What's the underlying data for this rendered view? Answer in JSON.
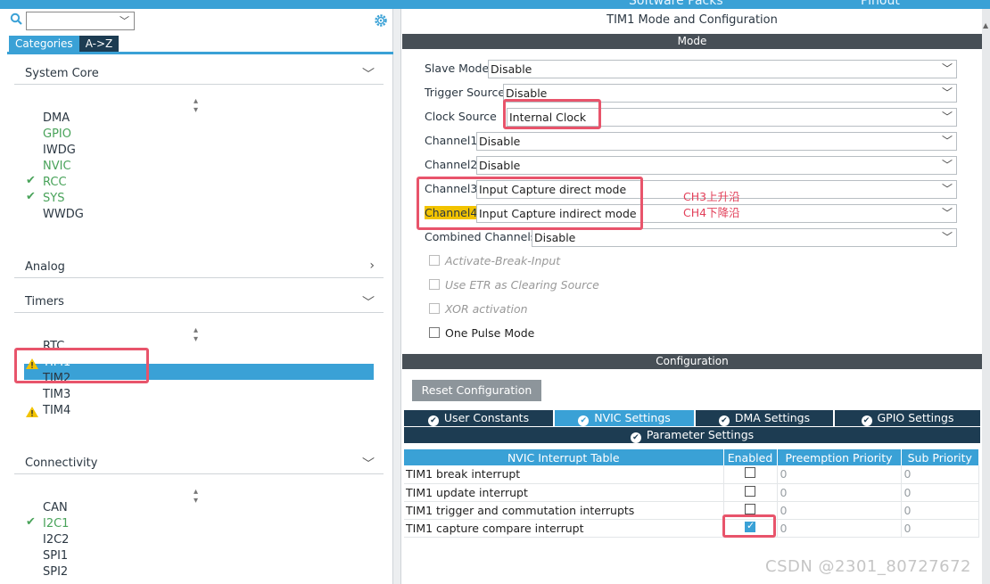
{
  "top": {
    "left_text": "Software Packs",
    "right_text": "Pinout"
  },
  "search": {
    "value": ""
  },
  "tabs": {
    "categories": "Categories",
    "az": "A->Z"
  },
  "sections": {
    "system_core": {
      "label": "System Core",
      "items": [
        {
          "name": "DMA",
          "status": "none"
        },
        {
          "name": "GPIO",
          "status": "green"
        },
        {
          "name": "IWDG",
          "status": "none"
        },
        {
          "name": "NVIC",
          "status": "green"
        },
        {
          "name": "RCC",
          "status": "check"
        },
        {
          "name": "SYS",
          "status": "check"
        },
        {
          "name": "WWDG",
          "status": "none"
        }
      ]
    },
    "analog": {
      "label": "Analog"
    },
    "timers": {
      "label": "Timers",
      "items": [
        {
          "name": "RTC",
          "status": "none"
        },
        {
          "name": "TIM1",
          "status": "warn"
        },
        {
          "name": "TIM2",
          "status": "none"
        },
        {
          "name": "TIM3",
          "status": "none"
        },
        {
          "name": "TIM4",
          "status": "warn"
        }
      ]
    },
    "connectivity": {
      "label": "Connectivity",
      "items": [
        {
          "name": "CAN",
          "status": "none"
        },
        {
          "name": "I2C1",
          "status": "check"
        },
        {
          "name": "I2C2",
          "status": "none"
        },
        {
          "name": "SPI1",
          "status": "none"
        },
        {
          "name": "SPI2",
          "status": "none"
        }
      ]
    }
  },
  "right": {
    "title": "TIM1 Mode and Configuration",
    "mode_header": "Mode",
    "fields": {
      "slave_mode": {
        "label": "Slave Mode",
        "value": "Disable"
      },
      "trigger_source": {
        "label": "Trigger Source",
        "value": "Disable"
      },
      "clock_source": {
        "label": "Clock Source",
        "value": "Internal Clock"
      },
      "channel1": {
        "label": "Channel1",
        "value": "Disable"
      },
      "channel2": {
        "label": "Channel2",
        "value": "Disable"
      },
      "channel3": {
        "label": "Channel3",
        "value": "Input Capture direct mode"
      },
      "channel4": {
        "label": "Channel4",
        "value": "Input Capture indirect mode"
      },
      "combined_channels": {
        "label": "Combined Channels",
        "value": "Disable"
      }
    },
    "checkboxes": {
      "activate_break_input": "Activate-Break-Input",
      "use_etr": "Use ETR as Clearing Source",
      "xor_activation": "XOR activation",
      "one_pulse_mode": "One Pulse Mode"
    },
    "annotations": {
      "ch3": "CH3上升沿",
      "ch4": "CH4下降沿"
    },
    "config_header": "Configuration",
    "reset_button": "Reset Configuration",
    "config_tabs": {
      "user_constants": "User Constants",
      "nvic_settings": "NVIC Settings",
      "dma_settings": "DMA Settings",
      "gpio_settings": "GPIO Settings",
      "parameter_settings": "Parameter Settings"
    },
    "nvic_table": {
      "headers": [
        "NVIC Interrupt Table",
        "Enabled",
        "Preemption Priority",
        "Sub Priority"
      ],
      "rows": [
        {
          "name": "TIM1 break interrupt",
          "enabled": false,
          "preemption": "0",
          "sub": "0"
        },
        {
          "name": "TIM1 update interrupt",
          "enabled": false,
          "preemption": "0",
          "sub": "0"
        },
        {
          "name": "TIM1 trigger and commutation interrupts",
          "enabled": false,
          "preemption": "0",
          "sub": "0"
        },
        {
          "name": "TIM1 capture compare interrupt",
          "enabled": true,
          "preemption": "0",
          "sub": "0"
        }
      ]
    }
  },
  "watermark": "CSDN @2301_80727672",
  "colors": {
    "accent": "#3aa1d6",
    "dark": "#1d3c52",
    "header_bar": "#474f56",
    "annotation": "#e8546b",
    "ok": "#49a35a",
    "warn": "#f2c300"
  }
}
